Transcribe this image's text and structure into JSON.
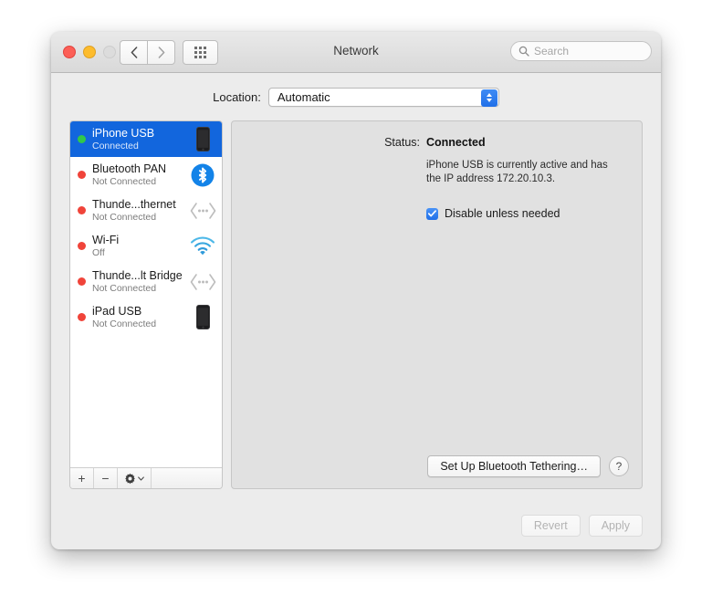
{
  "window": {
    "title": "Network",
    "traffic_lights": [
      "close",
      "minimize",
      "zoom"
    ],
    "nav_back_icon": "chevron-left-icon",
    "nav_forward_icon": "chevron-right-icon",
    "grid_icon": "grid-view-icon"
  },
  "search": {
    "placeholder": "Search",
    "value": "",
    "icon": "search-icon"
  },
  "location": {
    "label": "Location:",
    "value": "Automatic",
    "options": [
      "Automatic"
    ]
  },
  "sidebar": {
    "items": [
      {
        "name": "iPhone USB",
        "status": "Connected",
        "status_color": "#31c84a",
        "icon": "iphone-device-icon",
        "selected": true
      },
      {
        "name": "Bluetooth PAN",
        "status": "Not Connected",
        "status_color": "#f0443a",
        "icon": "bluetooth-icon",
        "selected": false
      },
      {
        "name": "Thunde...thernet",
        "status": "Not Connected",
        "status_color": "#f0443a",
        "icon": "thunderbolt-ethernet-icon",
        "selected": false
      },
      {
        "name": "Wi-Fi",
        "status": "Off",
        "status_color": "#f0443a",
        "icon": "wifi-icon",
        "selected": false
      },
      {
        "name": "Thunde...lt Bridge",
        "status": "Not Connected",
        "status_color": "#f0443a",
        "icon": "thunderbolt-bridge-icon",
        "selected": false
      },
      {
        "name": "iPad USB",
        "status": "Not Connected",
        "status_color": "#f0443a",
        "icon": "ipad-device-icon",
        "selected": false
      }
    ],
    "toolbar": {
      "add_label": "+",
      "remove_label": "−",
      "actions_icon": "gear-icon",
      "actions_chevron": "⌄"
    }
  },
  "panel": {
    "status_label": "Status:",
    "status_value": "Connected",
    "description": "iPhone USB is currently active and has the IP address 172.20.10.3.",
    "checkbox_label": "Disable unless needed",
    "checkbox_checked": true,
    "checkmark": "✓",
    "setup_button": "Set Up Bluetooth Tethering…",
    "help_button": "?"
  },
  "footer": {
    "revert_label": "Revert",
    "apply_label": "Apply",
    "revert_enabled": false,
    "apply_enabled": false
  },
  "colors": {
    "selection_blue": "#1266dd",
    "accent_blue": "#1f6fe8",
    "connected_green": "#31c84a",
    "disconnected_red": "#f0443a"
  }
}
